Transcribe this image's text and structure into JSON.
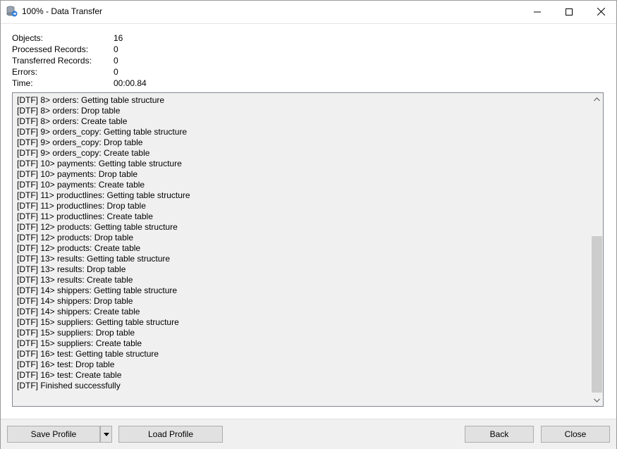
{
  "window": {
    "title": "100% - Data Transfer"
  },
  "stats": [
    {
      "label": "Objects:",
      "value": "16"
    },
    {
      "label": "Processed Records:",
      "value": "0"
    },
    {
      "label": "Transferred Records:",
      "value": "0"
    },
    {
      "label": "Errors:",
      "value": "0"
    },
    {
      "label": "Time:",
      "value": "00:00.84"
    }
  ],
  "log": [
    "[DTF] 8> orders: Getting table structure",
    "[DTF] 8> orders: Drop table",
    "[DTF] 8> orders: Create table",
    "[DTF] 9> orders_copy: Getting table structure",
    "[DTF] 9> orders_copy: Drop table",
    "[DTF] 9> orders_copy: Create table",
    "[DTF] 10> payments: Getting table structure",
    "[DTF] 10> payments: Drop table",
    "[DTF] 10> payments: Create table",
    "[DTF] 11> productlines: Getting table structure",
    "[DTF] 11> productlines: Drop table",
    "[DTF] 11> productlines: Create table",
    "[DTF] 12> products: Getting table structure",
    "[DTF] 12> products: Drop table",
    "[DTF] 12> products: Create table",
    "[DTF] 13> results: Getting table structure",
    "[DTF] 13> results: Drop table",
    "[DTF] 13> results: Create table",
    "[DTF] 14> shippers: Getting table structure",
    "[DTF] 14> shippers: Drop table",
    "[DTF] 14> shippers: Create table",
    "[DTF] 15> suppliers: Getting table structure",
    "[DTF] 15> suppliers: Drop table",
    "[DTF] 15> suppliers: Create table",
    "[DTF] 16> test: Getting table structure",
    "[DTF] 16> test: Drop table",
    "[DTF] 16> test: Create table",
    "[DTF] Finished successfully"
  ],
  "buttons": {
    "save_profile": "Save Profile",
    "load_profile": "Load Profile",
    "back": "Back",
    "close": "Close"
  },
  "icons": {
    "app": "data-transfer-icon",
    "minimize": "minimize-icon",
    "maximize": "maximize-icon",
    "close": "close-icon",
    "scroll_up": "chevron-up-icon",
    "scroll_down": "chevron-down-icon",
    "dropdown": "dropdown-arrow-icon"
  }
}
